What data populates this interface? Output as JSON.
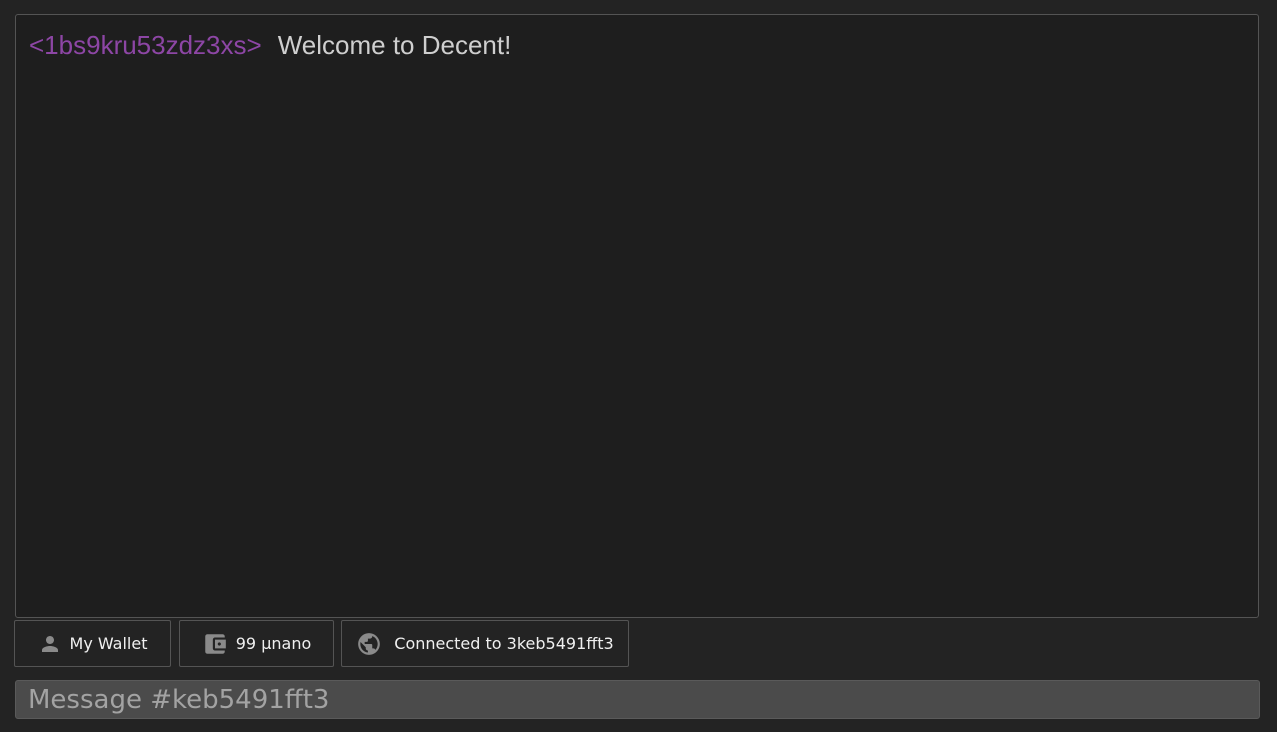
{
  "messages": [
    {
      "author": "<1bs9kru53zdz3xs>",
      "text": "Welcome to Decent!"
    }
  ],
  "status_bar": {
    "wallet": {
      "label": "My Wallet",
      "icon": "person-icon"
    },
    "balance": {
      "label": "99 μnano",
      "icon": "wallet-icon"
    },
    "connection": {
      "label": "Connected to 3keb5491fft3",
      "icon": "globe-icon"
    }
  },
  "composer": {
    "placeholder": "Message #keb5491fft3",
    "value": ""
  },
  "colors": {
    "background": "#232323",
    "panel": "#1e1e1e",
    "author": "#8d46a5",
    "message_text": "#cfcfcf",
    "input_bg": "#4b4b4b"
  }
}
